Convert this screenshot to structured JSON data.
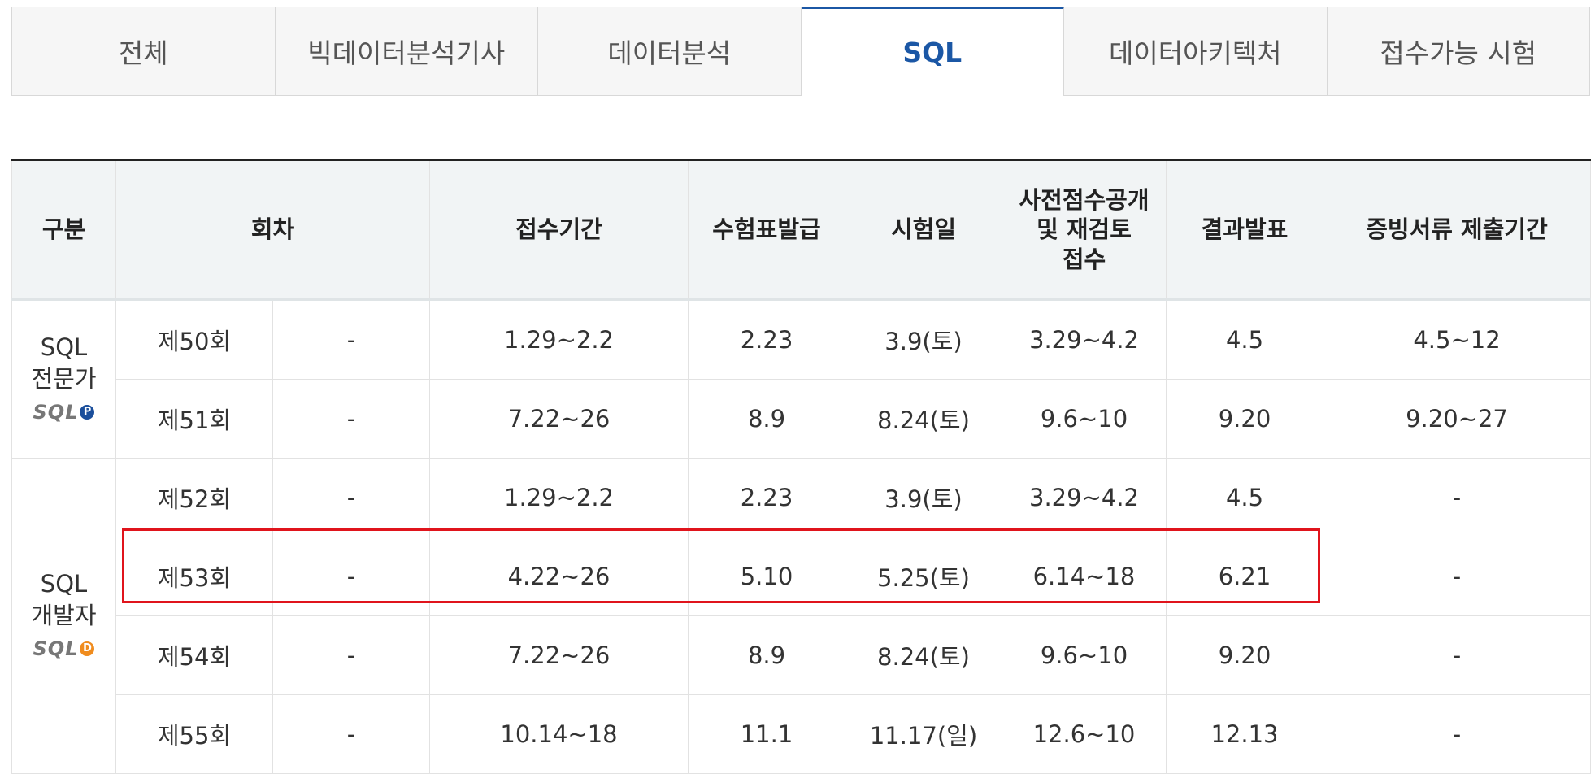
{
  "tabs": [
    {
      "label": "전체",
      "active": false
    },
    {
      "label": "빅데이터분석기사",
      "active": false
    },
    {
      "label": "데이터분석",
      "active": false
    },
    {
      "label": "SQL",
      "active": true
    },
    {
      "label": "데이터아키텍처",
      "active": false
    },
    {
      "label": "접수가능 시험",
      "active": false
    }
  ],
  "table": {
    "headers": {
      "category": "구분",
      "round": "회차",
      "registration": "접수기간",
      "ticket": "수험표발급",
      "exam_date": "시험일",
      "pre_score": "사전점수공개\n및 재검토\n접수",
      "result": "결과발표",
      "documents": "증빙서류 제출기간"
    },
    "groups": [
      {
        "name": "SQL\n전문가",
        "logo_text": "SQL",
        "badge": "P",
        "badge_color": "#1b4f9c"
      },
      {
        "name": "SQL\n개발자",
        "logo_text": "SQL",
        "badge": "D",
        "badge_color": "#f08c1e"
      }
    ],
    "rows": [
      {
        "round": "제50회",
        "extra": "-",
        "registration": "1.29~2.2",
        "ticket": "2.23",
        "exam_date": "3.9(토)",
        "pre_score": "3.29~4.2",
        "result": "4.5",
        "documents": "4.5~12"
      },
      {
        "round": "제51회",
        "extra": "-",
        "registration": "7.22~26",
        "ticket": "8.9",
        "exam_date": "8.24(토)",
        "pre_score": "9.6~10",
        "result": "9.20",
        "documents": "9.20~27"
      },
      {
        "round": "제52회",
        "extra": "-",
        "registration": "1.29~2.2",
        "ticket": "2.23",
        "exam_date": "3.9(토)",
        "pre_score": "3.29~4.2",
        "result": "4.5",
        "documents": "-"
      },
      {
        "round": "제53회",
        "extra": "-",
        "registration": "4.22~26",
        "ticket": "5.10",
        "exam_date": "5.25(토)",
        "pre_score": "6.14~18",
        "result": "6.21",
        "documents": "-"
      },
      {
        "round": "제54회",
        "extra": "-",
        "registration": "7.22~26",
        "ticket": "8.9",
        "exam_date": "8.24(토)",
        "pre_score": "9.6~10",
        "result": "9.20",
        "documents": "-"
      },
      {
        "round": "제55회",
        "extra": "-",
        "registration": "10.14~18",
        "ticket": "11.1",
        "exam_date": "11.17(일)",
        "pre_score": "12.6~10",
        "result": "12.13",
        "documents": "-"
      }
    ]
  },
  "highlight_color": "#e0141c"
}
